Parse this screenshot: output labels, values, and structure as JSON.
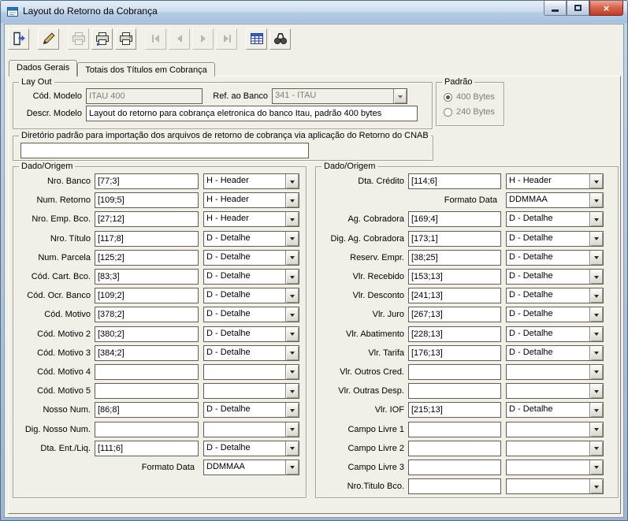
{
  "window": {
    "title": "Layout do Retorno da Cobrança",
    "controls": {
      "minimize": "minimize-icon",
      "maximize": "maximize-icon",
      "close": "close-icon"
    }
  },
  "colors": {
    "window_bg": "#f0efe8",
    "titlebar_top": "#e3edf9",
    "titlebar_bottom": "#a6c0de",
    "close_button": "#d8654d",
    "accent_blue": "#2a56c6",
    "field_border": "#635f55",
    "disabled_text": "#7f7d77"
  },
  "toolbar": {
    "buttons": [
      {
        "icon": "exit-icon",
        "enabled": true
      },
      {
        "icon": "edit-pencil-icon",
        "enabled": true
      },
      {
        "icon": "print-icon",
        "enabled": false
      },
      {
        "icon": "print-export-icon",
        "enabled": true
      },
      {
        "icon": "print-report-icon",
        "enabled": true
      },
      {
        "icon": "nav-first-icon",
        "enabled": false
      },
      {
        "icon": "nav-prior-icon",
        "enabled": false
      },
      {
        "icon": "nav-next-icon",
        "enabled": false
      },
      {
        "icon": "nav-last-icon",
        "enabled": false
      },
      {
        "icon": "grid-view-icon",
        "enabled": true
      },
      {
        "icon": "search-binoculars-icon",
        "enabled": true
      }
    ]
  },
  "tabs": [
    {
      "label": "Dados Gerais",
      "active": true
    },
    {
      "label": "Totais dos Títulos em Cobrança",
      "active": false
    }
  ],
  "layout_group": {
    "legend": "Lay Out",
    "cod_modelo_label": "Cód. Modelo",
    "cod_modelo_value": "ITAU 400",
    "ref_banco_label": "Ref. ao Banco",
    "ref_banco_value": "341 - ITAU",
    "descr_modelo_label": "Descr. Modelo",
    "descr_modelo_value": "Layout do retorno para cobrança eletronica do banco Itau, padrão 400 bytes"
  },
  "padrao_group": {
    "legend": "Padrão",
    "options": [
      {
        "label": "400 Bytes",
        "selected": true
      },
      {
        "label": "240 Bytes",
        "selected": false
      }
    ]
  },
  "diretorio_group": {
    "legend": "Diretório padrão para importação dos arquivos de retorno de cobrança via aplicação  do Retorno do CNAB",
    "value": ""
  },
  "left_group": {
    "legend": "Dado/Origem",
    "rows": [
      {
        "label": "Nro. Banco",
        "value": "[77;3]",
        "origin": "H - Header",
        "type": "field"
      },
      {
        "label": "Num. Retorno",
        "value": "[109;5]",
        "origin": "H - Header",
        "type": "field"
      },
      {
        "label": "Nro. Emp. Bco.",
        "value": "[27;12]",
        "origin": "H - Header",
        "type": "field"
      },
      {
        "label": "Nro. Título",
        "value": "[117;8]",
        "origin": "D - Detalhe",
        "type": "field"
      },
      {
        "label": "Num. Parcela",
        "value": "[125;2]",
        "origin": "D - Detalhe",
        "type": "field"
      },
      {
        "label": "Cód. Cart. Bco.",
        "value": "[83;3]",
        "origin": "D - Detalhe",
        "type": "field"
      },
      {
        "label": "Cód. Ocr. Banco",
        "value": "[109;2]",
        "origin": "D - Detalhe",
        "type": "field"
      },
      {
        "label": "Cód. Motivo",
        "value": "[378;2]",
        "origin": "D - Detalhe",
        "type": "field"
      },
      {
        "label": "Cód. Motivo 2",
        "value": "[380;2]",
        "origin": "D - Detalhe",
        "type": "field"
      },
      {
        "label": "Cód. Motivo 3",
        "value": "[384;2]",
        "origin": "D - Detalhe",
        "type": "field"
      },
      {
        "label": "Cód. Motivo 4",
        "value": "",
        "origin": "",
        "type": "field"
      },
      {
        "label": "Cód. Motivo 5",
        "value": "",
        "origin": "",
        "type": "field"
      },
      {
        "label": "Nosso Num.",
        "value": "[86;8]",
        "origin": "D - Detalhe",
        "type": "field"
      },
      {
        "label": "Dig. Nosso Num.",
        "value": "",
        "origin": "",
        "type": "field"
      },
      {
        "label": "Dta. Ent./Liq.",
        "value": "[111;6]",
        "origin": "D - Detalhe",
        "type": "field"
      },
      {
        "label": "Formato Data",
        "value": "",
        "origin": "DDMMAA",
        "type": "format"
      }
    ]
  },
  "right_group": {
    "legend": "Dado/Origem",
    "rows": [
      {
        "label": "Dta. Crédito",
        "value": "[114;6]",
        "origin": "H - Header",
        "type": "field"
      },
      {
        "label": "Formato Data",
        "value": "",
        "origin": "DDMMAA",
        "type": "format"
      },
      {
        "label": "Ag. Cobradora",
        "value": "[169;4]",
        "origin": "D - Detalhe",
        "type": "field"
      },
      {
        "label": "Dig. Ag. Cobradora",
        "value": "[173;1]",
        "origin": "D - Detalhe",
        "type": "field"
      },
      {
        "label": "Reserv. Empr.",
        "value": "[38;25]",
        "origin": "D - Detalhe",
        "type": "field"
      },
      {
        "label": "Vlr. Recebido",
        "value": "[153;13]",
        "origin": "D - Detalhe",
        "type": "field"
      },
      {
        "label": "Vlr. Desconto",
        "value": "[241;13]",
        "origin": "D - Detalhe",
        "type": "field"
      },
      {
        "label": "Vlr. Juro",
        "value": "[267;13]",
        "origin": "D - Detalhe",
        "type": "field"
      },
      {
        "label": "Vlr. Abatimento",
        "value": "[228;13]",
        "origin": "D - Detalhe",
        "type": "field"
      },
      {
        "label": "Vlr. Tarifa",
        "value": "[176;13]",
        "origin": "D - Detalhe",
        "type": "field"
      },
      {
        "label": "Vlr. Outros Cred.",
        "value": "",
        "origin": "",
        "type": "field"
      },
      {
        "label": "Vlr. Outras Desp.",
        "value": "",
        "origin": "",
        "type": "field"
      },
      {
        "label": "Vlr. IOF",
        "value": "[215;13]",
        "origin": "D - Detalhe",
        "type": "field"
      },
      {
        "label": "Campo Livre 1",
        "value": "",
        "origin": "",
        "type": "field"
      },
      {
        "label": "Campo Livre 2",
        "value": "",
        "origin": "",
        "type": "field"
      },
      {
        "label": "Campo Livre 3",
        "value": "",
        "origin": "",
        "type": "field"
      },
      {
        "label": "Nro.Titulo Bco.",
        "value": "",
        "origin": "",
        "type": "field"
      }
    ]
  }
}
